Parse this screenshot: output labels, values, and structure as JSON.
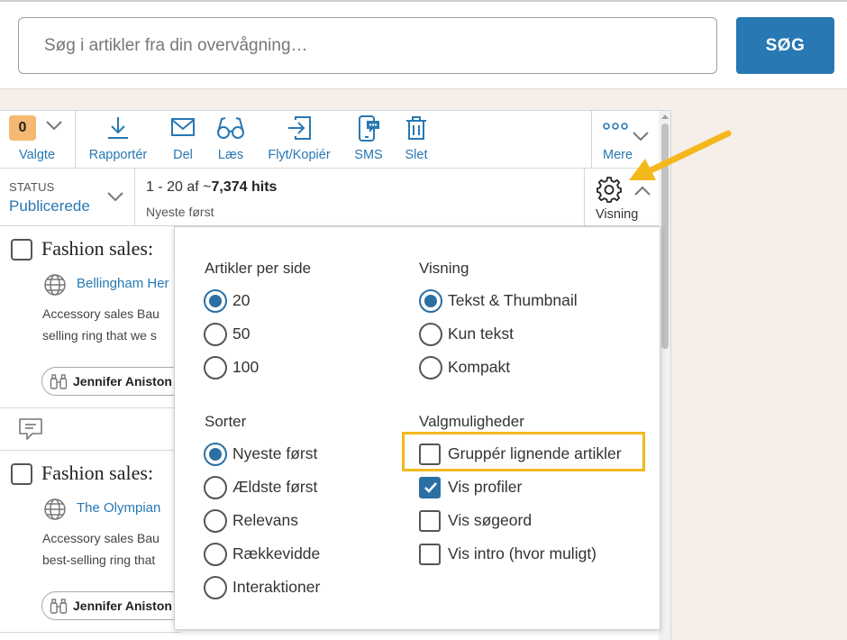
{
  "search": {
    "placeholder": "Søg i artikler fra din overvågning…",
    "button_label": "SØG"
  },
  "toolbar": {
    "selected_count": "0",
    "selected_label": "Valgte",
    "actions": [
      {
        "label": "Rapportér",
        "icon": "download-icon"
      },
      {
        "label": "Del",
        "icon": "envelope-icon"
      },
      {
        "label": "Læs",
        "icon": "glasses-icon"
      },
      {
        "label": "Flyt/Kopiér",
        "icon": "move-copy-icon"
      },
      {
        "label": "SMS",
        "icon": "sms-phone-icon"
      },
      {
        "label": "Slet",
        "icon": "trash-icon"
      }
    ],
    "more_label": "Mere"
  },
  "status": {
    "caption": "STATUS",
    "value": "Publicerede",
    "hits_prefix": "1 - 20 af ~",
    "hits_bold": "7,374 hits",
    "sort": "Nyeste først",
    "view_label": "Visning"
  },
  "articles": [
    {
      "title": "Fashion sales:",
      "source": "Bellingham Her",
      "snippet_1": "Accessory sales Bau",
      "snippet_2": "selling ring that we s",
      "tag": "Jennifer Aniston"
    },
    {
      "title": "Fashion sales:",
      "source": "The Olympian",
      "snippet_1": "Accessory sales Bau",
      "snippet_2": "best-selling ring that",
      "tag": "Jennifer Aniston"
    }
  ],
  "dropdown": {
    "per_page": {
      "heading": "Artikler per side",
      "options": [
        "20",
        "50",
        "100"
      ],
      "selected": "20"
    },
    "view": {
      "heading": "Visning",
      "options": [
        "Tekst & Thumbnail",
        "Kun tekst",
        "Kompakt"
      ],
      "selected": "Tekst & Thumbnail"
    },
    "sort": {
      "heading": "Sorter",
      "options": [
        "Nyeste først",
        "Ældste først",
        "Relevans",
        "Rækkevidde",
        "Interaktioner"
      ],
      "selected": "Nyeste først"
    },
    "options": {
      "heading": "Valgmuligheder",
      "items": [
        {
          "label": "Gruppér lignende artikler",
          "checked": false
        },
        {
          "label": "Vis profiler",
          "checked": true
        },
        {
          "label": "Vis søgeord",
          "checked": false
        },
        {
          "label": "Vis intro (hvor muligt)",
          "checked": false
        }
      ]
    }
  },
  "colors": {
    "accent": "#2878b3",
    "highlight": "#f4b81c",
    "badge": "#f5b971",
    "background": "#f6eee9"
  }
}
